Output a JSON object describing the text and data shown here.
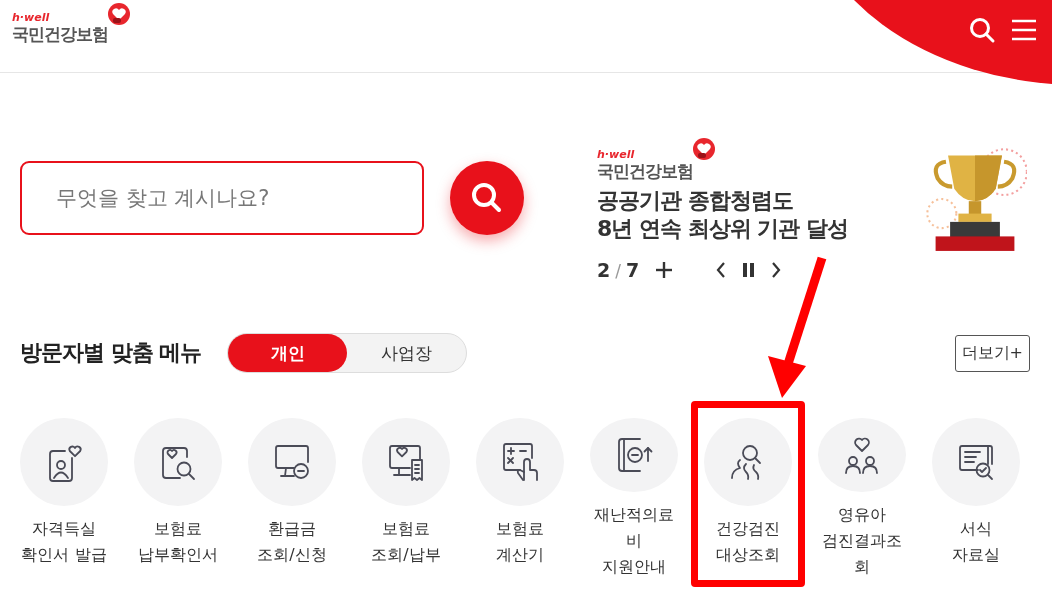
{
  "header": {
    "logo": {
      "tagline": "h·well",
      "name": "국민건강보험"
    }
  },
  "search": {
    "placeholder": "무엇을 찾고 계시나요?"
  },
  "banner": {
    "logo": {
      "tagline": "h·well",
      "name": "국민건강보험"
    },
    "title_lines": [
      "공공기관 종합청렴도",
      "8년 연속 최상위 기관 달성"
    ],
    "counter": {
      "current": "2",
      "separator": "/",
      "total": "7"
    },
    "paused": false
  },
  "visitor_menu": {
    "title": "방문자별 맞춤 메뉴",
    "tabs": [
      {
        "label": "개인",
        "selected": true
      },
      {
        "label": "사업장",
        "selected": false
      }
    ],
    "more_button": "더보기+",
    "items": [
      {
        "kind": "id-card",
        "label_lines": [
          "자격득실",
          "확인서 발급"
        ],
        "highlighted": false
      },
      {
        "kind": "doc-search",
        "label_lines": [
          "보험료",
          "납부확인서"
        ],
        "highlighted": false
      },
      {
        "kind": "monitor-coin",
        "label_lines": [
          "환급금",
          "조회/신청"
        ],
        "highlighted": false
      },
      {
        "kind": "monitor-receipt",
        "label_lines": [
          "보험료",
          "조회/납부"
        ],
        "highlighted": false
      },
      {
        "kind": "calculator",
        "label_lines": [
          "보험료",
          "계산기"
        ],
        "highlighted": false
      },
      {
        "kind": "book-coin",
        "label_lines": [
          "재난적의료",
          "비",
          "지원안내"
        ],
        "highlighted": false
      },
      {
        "kind": "people-search",
        "label_lines": [
          "건강검진",
          "대상조회"
        ],
        "highlighted": true
      },
      {
        "kind": "family",
        "label_lines": [
          "영유아",
          "검진결과조",
          "회"
        ],
        "highlighted": false
      },
      {
        "kind": "doc-check",
        "label_lines": [
          "서식",
          "자료실"
        ],
        "highlighted": false
      }
    ]
  },
  "annotation": {
    "arrow": true
  }
}
